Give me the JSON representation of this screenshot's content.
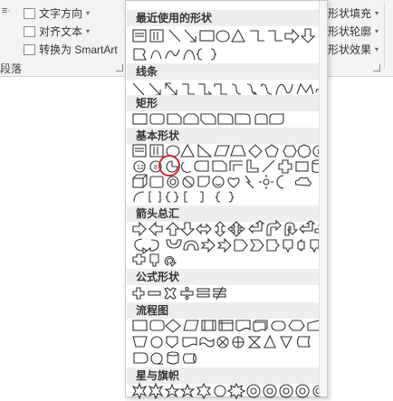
{
  "ribbon": {
    "text_direction": "文字方向",
    "align_text": "对齐文本",
    "convert_smartart": "转换为 SmartArt",
    "group_label_left": "段落",
    "shape_fill": "形状填充",
    "shape_outline": "形状轮廓",
    "shape_effects": "形状效果"
  },
  "gallery": {
    "sections": {
      "recent": "最近使用的形状",
      "lines": "线条",
      "rectangles": "矩形",
      "basic": "基本形状",
      "arrows": "箭头总汇",
      "equation": "公式形状",
      "flowchart": "流程图",
      "stars": "星与旗帜"
    },
    "selected_shape": "pie-shape"
  },
  "colors": {
    "highlight": "#d0262d",
    "shape_stroke": "#333333"
  }
}
